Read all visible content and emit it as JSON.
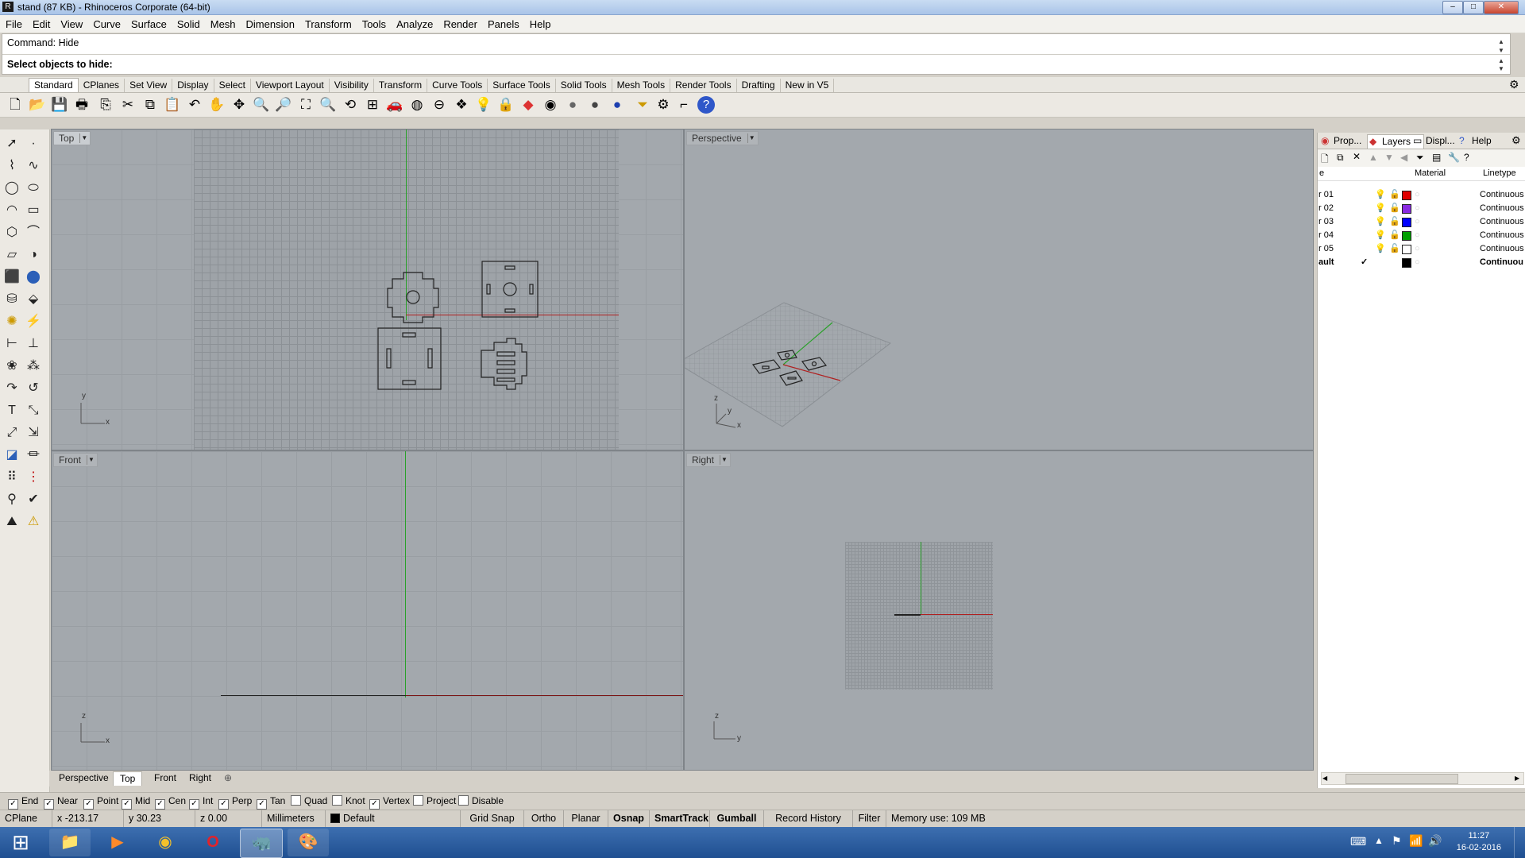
{
  "window": {
    "title": "stand (87 KB) - Rhinoceros Corporate (64-bit)"
  },
  "menu": [
    "File",
    "Edit",
    "View",
    "Curve",
    "Surface",
    "Solid",
    "Mesh",
    "Dimension",
    "Transform",
    "Tools",
    "Analyze",
    "Render",
    "Panels",
    "Help"
  ],
  "command": {
    "history": "Command: Hide",
    "prompt": "Select objects to hide:"
  },
  "toolbar_tabs": [
    "Standard",
    "CPlanes",
    "Set View",
    "Display",
    "Select",
    "Viewport Layout",
    "Visibility",
    "Transform",
    "Curve Tools",
    "Surface Tools",
    "Solid Tools",
    "Mesh Tools",
    "Render Tools",
    "Drafting",
    "New in V5"
  ],
  "toolbar_icons": [
    "new-icon",
    "open-icon",
    "save-icon",
    "print-icon",
    "import-icon",
    "cut-icon",
    "copy-icon",
    "paste-icon",
    "undo-icon",
    "pan-hand-icon",
    "rotate-view-icon",
    "zoom-dynamic-icon",
    "zoom-window-icon",
    "zoom-extents-icon",
    "zoom-selected-icon",
    "undo-view-icon",
    "four-viewports-icon",
    "car-render-icon",
    "named-view-icon",
    "cplane-icon",
    "show-objects-icon",
    "light-bulb-icon",
    "lock-icon",
    "layer-icon",
    "color-wheel-icon",
    "shaded-sphere-icon",
    "rendered-sphere-icon",
    "render-icon",
    "select-filter-icon",
    "options-gear-icon",
    "dimension-icon",
    "help-icon"
  ],
  "viewports": {
    "top": {
      "label": "Top",
      "axis_h": "x",
      "axis_v": "y"
    },
    "perspective": {
      "label": "Perspective",
      "axis_h": "x",
      "axis_v": "z",
      "axis_d": "y"
    },
    "front": {
      "label": "Front",
      "axis_h": "x",
      "axis_v": "z"
    },
    "right": {
      "label": "Right",
      "axis_h": "y",
      "axis_v": "z"
    }
  },
  "viewport_tabs": [
    "Perspective",
    "Top",
    "Front",
    "Right"
  ],
  "panel": {
    "tabs": [
      "Prop...",
      "Layers",
      "Displ...",
      "Help"
    ],
    "columns": {
      "name": "e",
      "material": "Material",
      "linetype": "Linetype"
    },
    "layers": [
      {
        "name": "r 01",
        "color": "#e00000",
        "linetype": "Continuous",
        "current": false
      },
      {
        "name": "r 02",
        "color": "#8a2be2",
        "linetype": "Continuous",
        "current": false
      },
      {
        "name": "r 03",
        "color": "#0000ff",
        "linetype": "Continuous",
        "current": false
      },
      {
        "name": "r 04",
        "color": "#00a000",
        "linetype": "Continuous",
        "current": false
      },
      {
        "name": "r 05",
        "color": "#ffffff",
        "linetype": "Continuous",
        "current": false
      },
      {
        "name": "ault",
        "color": "#000000",
        "linetype": "Continuou",
        "current": true
      }
    ]
  },
  "osnap": [
    {
      "label": "End",
      "checked": true
    },
    {
      "label": "Near",
      "checked": true
    },
    {
      "label": "Point",
      "checked": true
    },
    {
      "label": "Mid",
      "checked": true
    },
    {
      "label": "Cen",
      "checked": true
    },
    {
      "label": "Int",
      "checked": true
    },
    {
      "label": "Perp",
      "checked": true
    },
    {
      "label": "Tan",
      "checked": true
    },
    {
      "label": "Quad",
      "checked": false
    },
    {
      "label": "Knot",
      "checked": false
    },
    {
      "label": "Vertex",
      "checked": true
    },
    {
      "label": "Project",
      "checked": false
    },
    {
      "label": "Disable",
      "checked": false
    }
  ],
  "status": {
    "cplane": "CPlane",
    "x": "x -213.17",
    "y": "y 30.23",
    "z": "z 0.00",
    "units": "Millimeters",
    "layer": "Default",
    "grid_snap": "Grid Snap",
    "ortho": "Ortho",
    "planar": "Planar",
    "osnap": "Osnap",
    "smarttrack": "SmartTrack",
    "gumball": "Gumball",
    "record_history": "Record History",
    "filter": "Filter",
    "memory": "Memory use: 109 MB"
  },
  "taskbar": {
    "time": "11:27",
    "date": "16-02-2016"
  }
}
